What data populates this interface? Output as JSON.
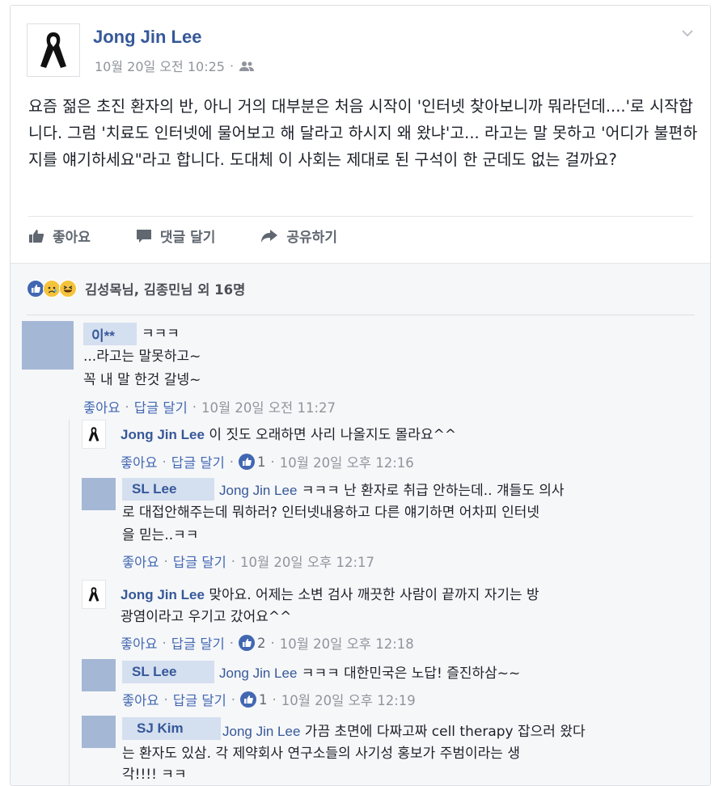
{
  "post": {
    "author": "Jong Jin Lee",
    "timestamp": "10월 20일 오전 10:25",
    "audience_icon": "friends-icon",
    "body": "요즘 젊은 초진 환자의 반, 아니 거의 대부분은 처음 시작이 '인터넷 찾아보니까 뭐라던데....'로 시작합니다. 그럼 '치료도 인터넷에 물어보고 해 달라고 하시지 왜 왔냐'고... 라고는 말 못하고 '어디가 불편하지를 얘기하세요\"라고 합니다. 도대체 이 사회는 제대로 된 구석이 한 군데도 없는 걸까요?"
  },
  "actions": {
    "like": "좋아요",
    "comment": "댓글 달기",
    "share": "공유하기"
  },
  "reactions": {
    "icons": [
      "like-icon",
      "sad-icon",
      "haha-icon"
    ],
    "summary": "김성목님, 김종민님 외 16명"
  },
  "comments": [
    {
      "author": "이**",
      "line1": "ㅋㅋㅋ",
      "line2": "...라고는 말못하고~",
      "line3": "꼭 내 말 한것 갈넹~",
      "like": "좋아요",
      "reply": "답글 달기",
      "time": "10월 20일 오전 11:27"
    }
  ],
  "replies": [
    {
      "author": "Jong Jin Lee",
      "text": " 이 짓도 오래하면 사리 나올지도 몰라요^^",
      "like": "좋아요",
      "reply": "답글 달기",
      "likes_count": "1",
      "time": "10월 20일 오후 12:16"
    },
    {
      "author": "SL      Lee",
      "mention": "Jong Jin Lee",
      "text_line1": " ㅋㅋㅋ 난 환자로 취급 안하는데.. 걔들도 의사",
      "text_line2": "로 대접안해주는데 뭐하러? 인터넷내용하고 다른 얘기하면 어차피 인터넷",
      "text_line3": "을 믿는..ㅋㅋ",
      "like": "좋아요",
      "reply": "답글 달기",
      "time": "10월 20일 오후 12:17"
    },
    {
      "author": "Jong Jin Lee",
      "text_line1": " 맞아요. 어제는 소변 검사 깨끗한 사람이 끝까지 자기는 방",
      "text_line2": "광염이라고 우기고 갔어요^^",
      "like": "좋아요",
      "reply": "답글 달기",
      "likes_count": "2",
      "time": "10월 20일 오후 12:18"
    },
    {
      "author": "SL      Lee",
      "mention": "Jong Jin Lee",
      "text": " ㅋㅋㅋ 대한민국은 노답! 즐진하삼~~",
      "like": "좋아요",
      "reply": "답글 달기",
      "likes_count": "1",
      "time": "10월 20일 오후 12:19"
    },
    {
      "author": "SJ    Kim",
      "mention": "Jong Jin Lee",
      "text_line1": " 가끔 초면에 다짜고짜 cell therapy 잡으러 왔다",
      "text_line2": "는 환자도 있삼. 각 제약회사 연구소들의 사기성 홍보가 주범이라는 생",
      "text_line3": "각!!!! ㅋㅋ"
    }
  ],
  "colors": {
    "link": "#365899",
    "meta": "#90949c",
    "like_blue": "#4267b2",
    "placeholder_avatar": "#a4b7d5",
    "name_highlight": "#d4dff0"
  }
}
